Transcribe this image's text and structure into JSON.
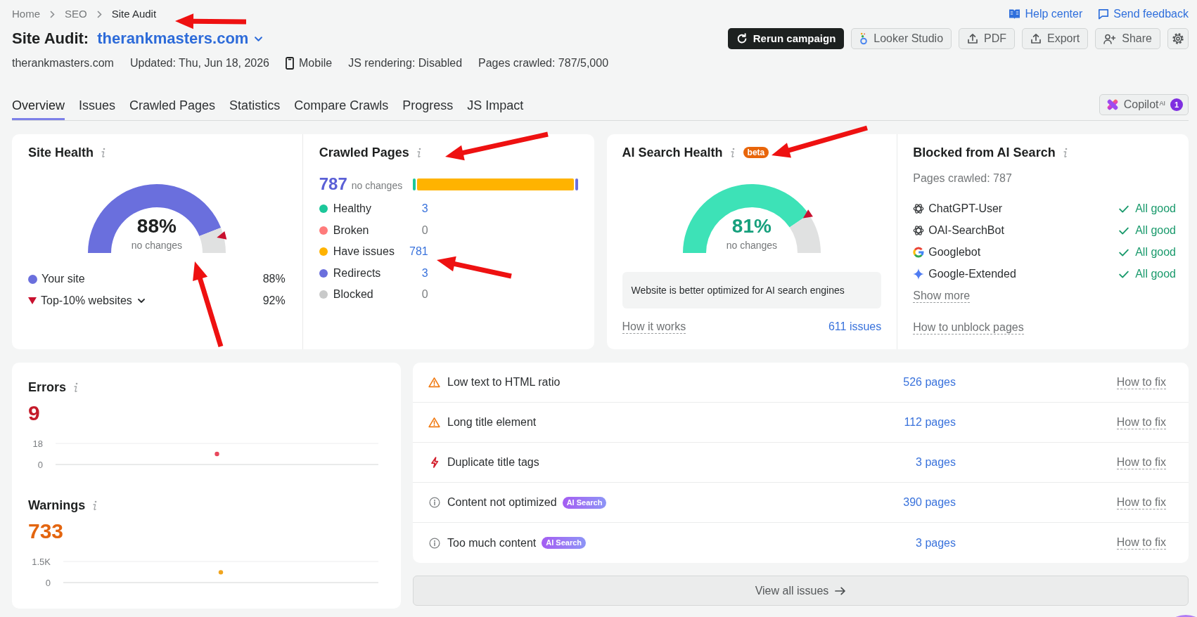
{
  "breadcrumb": [
    {
      "label": "Home",
      "current": false
    },
    {
      "label": "SEO",
      "current": false
    },
    {
      "label": "Site Audit",
      "current": true
    }
  ],
  "help_links": {
    "help_center": "Help center",
    "feedback": "Send feedback"
  },
  "title": {
    "label": "Site Audit:",
    "project": "therankmasters.com"
  },
  "actions": {
    "rerun": "Rerun campaign",
    "looker_studio": "Looker Studio",
    "pdf": "PDF",
    "export": "Export",
    "share": "Share"
  },
  "info": {
    "domain": "therankmasters.com",
    "updated": "Updated: Thu, Jun 18, 2026",
    "device": "Mobile",
    "js_rendering": "JS rendering: Disabled",
    "pages_crawled": "Pages crawled: 787/5,000"
  },
  "tabs": [
    {
      "label": "Overview",
      "selected": true
    },
    {
      "label": "Issues",
      "selected": false
    },
    {
      "label": "Crawled Pages",
      "selected": false
    },
    {
      "label": "Statistics",
      "selected": false
    },
    {
      "label": "Compare Crawls",
      "selected": false
    },
    {
      "label": "Progress",
      "selected": false
    },
    {
      "label": "JS Impact",
      "selected": false
    }
  ],
  "copilot": {
    "label": "Copilot$^{AI}$",
    "badge": "1"
  },
  "site_health": {
    "title": "Site Health",
    "chart_data": {
      "type": "donut",
      "categories": [
        null,
        null
      ],
      "values": [
        88,
        12
      ],
      "colors": [
        "#6a6fdd",
        "#e0e1e1"
      ]
    },
    "marker": {
      "level": 0.92
    },
    "value": "88%",
    "change": "no changes",
    "legend": [
      {
        "label": "Your site",
        "value": "88%",
        "kind": "dot",
        "color": "#6a6fdd",
        "dropdown": false
      },
      {
        "label": "Top-10% websites",
        "value": "92%",
        "kind": "triangle",
        "color": "#c8102e",
        "dropdown": true
      }
    ]
  },
  "crawled_pages": {
    "title": "Crawled Pages",
    "total": "787",
    "change": "no changes",
    "statuses": [
      {
        "label": "Healthy",
        "count": "3",
        "color": "#1cc79a",
        "linked": true
      },
      {
        "label": "Broken",
        "count": "0",
        "color": "#ff7b7b",
        "linked": false
      },
      {
        "label": "Have issues",
        "count": "781",
        "color": "#ffb300",
        "linked": true
      },
      {
        "label": "Redirects",
        "count": "3",
        "color": "#6a6fdd",
        "linked": true
      },
      {
        "label": "Blocked",
        "count": "0",
        "color": "#c9caca",
        "linked": false
      }
    ]
  },
  "ai_search_health": {
    "title": "AI Search Health",
    "badge": "beta",
    "chart_data": {
      "type": "donut",
      "categories": [
        null,
        null
      ],
      "values": [
        81,
        19
      ],
      "colors": [
        "#3de2b7",
        "#e0e1e1"
      ]
    },
    "marker": {
      "level": 0.81
    },
    "value": "81%",
    "change": "no changes",
    "message": "Website is better optimized for AI search engines",
    "how_it_works": "How it works",
    "issues_link": "611 issues"
  },
  "blocked_from_ai": {
    "title": "Blocked from AI Search",
    "pages_crawled": "Pages crawled: 787",
    "bots": [
      {
        "name": "ChatGPT-User",
        "kind": "knot",
        "status": "All good",
        "ok": true
      },
      {
        "name": "OAI-SearchBot",
        "kind": "knot",
        "status": "All good",
        "ok": true
      },
      {
        "name": "Googlebot",
        "kind": "glogo",
        "status": "All good",
        "ok": true
      },
      {
        "name": "Google-Extended",
        "kind": "sparkle",
        "status": "All good",
        "ok": true
      }
    ],
    "show_more": "Show more",
    "unblock_link": "How to unblock pages"
  },
  "errors": {
    "title": "Errors",
    "value": "9",
    "chart_data": {
      "type": "scatter",
      "categories": [
        null
      ],
      "values": [
        9
      ],
      "ylim": [
        0,
        18
      ],
      "yticks": [
        0,
        18
      ],
      "color": "#e8475c"
    }
  },
  "warnings": {
    "title": "Warnings",
    "value": "733",
    "chart_data": {
      "type": "scatter",
      "categories": [
        null
      ],
      "values": [
        733
      ],
      "ylim": [
        0,
        1500
      ],
      "yticks": [
        0,
        {
          "value": 1500,
          "label": "1.5K"
        }
      ],
      "color": "#f0a51e"
    }
  },
  "issues": [
    {
      "kind": "warning",
      "label": "Low text to HTML ratio",
      "pages": "526 pages",
      "fix": "How to fix"
    },
    {
      "kind": "warning",
      "label": "Long title element",
      "pages": "112 pages",
      "fix": "How to fix"
    },
    {
      "kind": "error",
      "label": "Duplicate title tags",
      "pages": "3 pages",
      "fix": "How to fix"
    },
    {
      "kind": "notice",
      "label": "Content not optimized",
      "badge": "AI Search",
      "pages": "390 pages",
      "fix": "How to fix"
    },
    {
      "kind": "notice",
      "label": "Too much content",
      "badge": "AI Search",
      "pages": "3 pages",
      "fix": "How to fix"
    }
  ],
  "view_all": "View all issues"
}
